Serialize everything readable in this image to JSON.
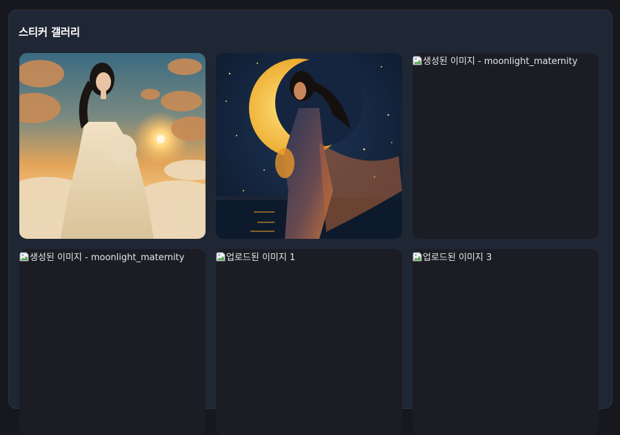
{
  "gallery": {
    "title": "스티커 갤러리",
    "items": [
      {
        "type": "image",
        "subject": "pregnant woman in white dress among clouds at sunset"
      },
      {
        "type": "image",
        "subject": "pregnant woman with golden crescent moon and stars"
      },
      {
        "type": "broken",
        "alt": "생성된 이미지 - moonlight_maternity"
      },
      {
        "type": "broken",
        "alt": "생성된 이미지 - moonlight_maternity"
      },
      {
        "type": "broken",
        "alt": "업로드된 이미지 1"
      },
      {
        "type": "broken",
        "alt": "업로드된 이미지 3"
      }
    ]
  },
  "colors": {
    "page_bg": "#17181d",
    "panel_bg": "#1f2634",
    "tile_bg": "#1c1d24",
    "title_text": "#ffffff"
  }
}
